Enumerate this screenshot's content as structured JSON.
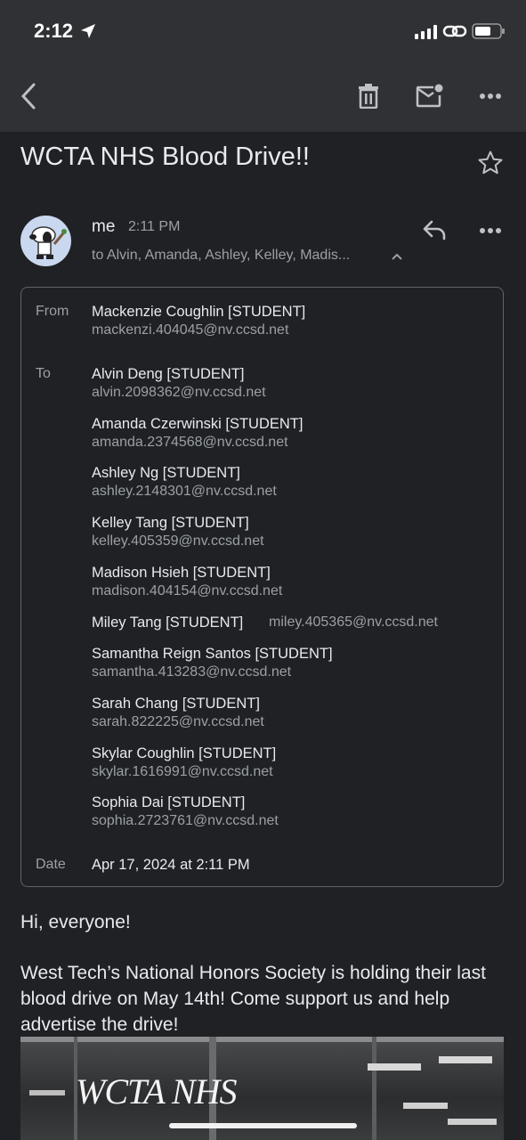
{
  "status": {
    "time": "2:12"
  },
  "email": {
    "subject": "WCTA NHS Blood Drive!!",
    "sender_short": "me",
    "sent_time": "2:11 PM",
    "to_summary": "to Alvin, Amanda, Ashley, Kelley, Madis...",
    "details": {
      "from_label": "From",
      "from_name": "Mackenzie Coughlin [STUDENT]",
      "from_email": "mackenzi.404045@nv.ccsd.net",
      "to_label": "To",
      "recipients": [
        {
          "name": "Alvin Deng [STUDENT]",
          "email": "alvin.2098362@nv.ccsd.net"
        },
        {
          "name": "Amanda Czerwinski [STUDENT]",
          "email": "amanda.2374568@nv.ccsd.net"
        },
        {
          "name": "Ashley Ng [STUDENT]",
          "email": "ashley.2148301@nv.ccsd.net"
        },
        {
          "name": "Kelley Tang [STUDENT]",
          "email": "kelley.405359@nv.ccsd.net"
        },
        {
          "name": "Madison Hsieh [STUDENT]",
          "email": "madison.404154@nv.ccsd.net"
        },
        {
          "name": "Miley Tang [STUDENT]",
          "email": "miley.405365@nv.ccsd.net"
        },
        {
          "name": "Samantha Reign Santos [STUDENT]",
          "email": "samantha.413283@nv.ccsd.net"
        },
        {
          "name": "Sarah Chang [STUDENT]",
          "email": "sarah.822225@nv.ccsd.net"
        },
        {
          "name": "Skylar Coughlin [STUDENT]",
          "email": "skylar.1616991@nv.ccsd.net"
        },
        {
          "name": "Sophia Dai [STUDENT]",
          "email": "sophia.2723761@nv.ccsd.net"
        }
      ],
      "date_label": "Date",
      "date_value": "Apr 17, 2024 at 2:11 PM"
    },
    "body": {
      "greeting": "Hi, everyone!",
      "paragraph": "West Tech’s National Honors Society is holding their last blood drive on May 14th! Come support us and help advertise the drive!",
      "poster_title": "WCTA NHS"
    }
  },
  "icons": {
    "back": "chevron-left-icon",
    "trash": "trash-icon",
    "mark_unread": "mail-unread-icon",
    "more": "more-horizontal-icon",
    "star": "star-icon",
    "reply": "reply-icon",
    "expand": "chevron-up-icon"
  },
  "colors": {
    "background": "#202124",
    "toolbar": "#303134",
    "text": "#e8eaed",
    "secondary_text": "#9aa0a6",
    "border": "#5f6368"
  }
}
